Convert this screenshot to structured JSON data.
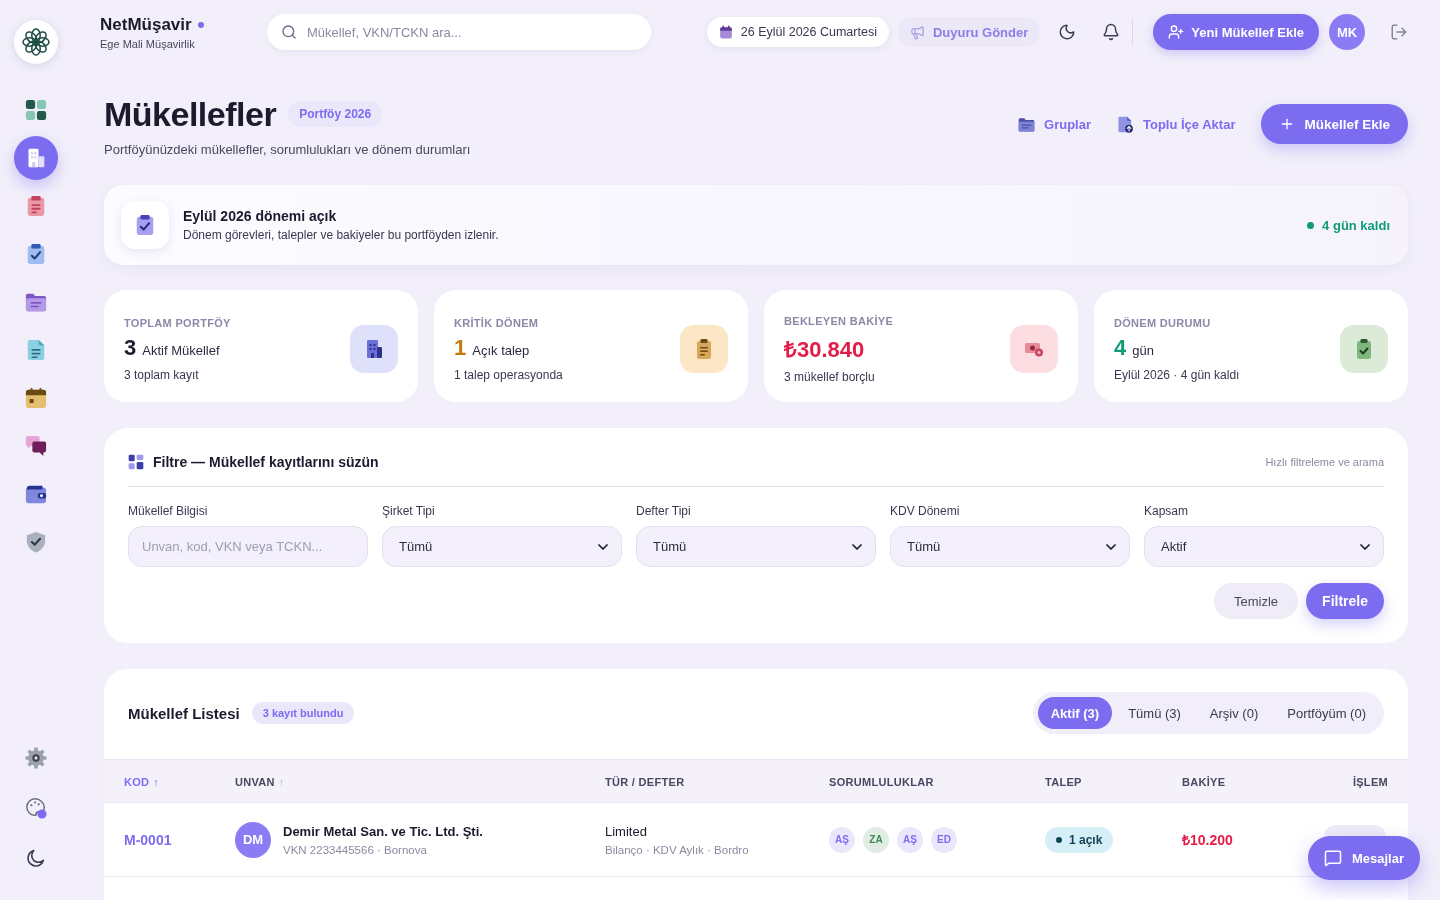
{
  "sidebar": {
    "nav": [
      {
        "selected": false
      },
      {
        "selected": true
      },
      {
        "selected": false
      },
      {
        "selected": false
      },
      {
        "selected": false
      },
      {
        "selected": false
      },
      {
        "selected": false
      },
      {
        "selected": false
      },
      {
        "selected": false
      },
      {
        "selected": false
      }
    ]
  },
  "topbar": {
    "brand": {
      "name": "NetMüşavir",
      "subtitle": "Ege Mali Müşavirlik"
    },
    "search": {
      "placeholder": "Mükellef, VKN/TCKN ara..."
    },
    "date": "26 Eylül 2026 Cumartesi",
    "announce_button": "Duyuru Gönder",
    "add_button": "Yeni Mükellef Ekle",
    "avatar": "MK"
  },
  "page_header": {
    "title": "Mükellefler",
    "badge": "Portföy 2026",
    "subtitle": "Portföyünüzdeki mükellefler, sorumlulukları ve dönem durumları",
    "actions": [
      {
        "kind": "link",
        "label": "Gruplar"
      },
      {
        "kind": "link",
        "label": "Toplu İçe Aktar"
      },
      {
        "kind": "primary",
        "label": "Mükellef Ekle"
      }
    ]
  },
  "period_banner": {
    "title": "Eylül 2026 dönemi açık",
    "text": "Dönem görevleri, talepler ve bakiyeler bu portföyden izlenir.",
    "status": "4 gün kaldı"
  },
  "stats": [
    {
      "label": "TOPLAM PORTFÖY",
      "value": "3",
      "unit": "Aktif Mükellef",
      "note": "3 toplam kayıt",
      "color": "#1c1b2e"
    },
    {
      "label": "KRİTİK DÖNEM",
      "value": "1",
      "unit": "Açık talep",
      "note": "1 talep operasyonda",
      "color": "#c27c0e"
    },
    {
      "label": "BEKLEYEN BAKİYE",
      "value": "₺30.840",
      "note": "3 mükellef borçlu",
      "color": "#e11d48"
    },
    {
      "label": "DÖNEM DURUMU",
      "value": "4",
      "unit": "gün",
      "note": "Eylül 2026 · 4 gün kaldı",
      "color": "#0f9b78"
    }
  ],
  "filter": {
    "title": "Filtre — Mükellef kayıtlarını süzün",
    "hint": "Hızlı filtreleme ve arama",
    "fields": [
      {
        "kind": "input",
        "label": "Mükellef Bilgisi",
        "placeholder": "Unvan, kod, VKN veya TCKN..."
      },
      {
        "kind": "select",
        "label": "Şirket Tipi",
        "value": "Tümü"
      },
      {
        "kind": "select",
        "label": "Defter Tipi",
        "value": "Tümü"
      },
      {
        "kind": "select",
        "label": "KDV Dönemi",
        "value": "Tümü"
      },
      {
        "kind": "select",
        "label": "Kapsam",
        "value": "Aktif"
      }
    ],
    "buttons": [
      {
        "kind": "secondary",
        "label": "Temizle"
      },
      {
        "kind": "primary",
        "label": "Filtrele"
      }
    ]
  },
  "list": {
    "title": "Mükellef Listesi",
    "count": "3 kayıt bulundu",
    "tabs": [
      {
        "label": "Aktif (3)",
        "selected": true
      },
      {
        "label": "Tümü (3)",
        "selected": false
      },
      {
        "label": "Arşiv (0)",
        "selected": false
      },
      {
        "label": "Portföyüm (0)",
        "selected": false
      }
    ],
    "table": {
      "columns": [
        {
          "label": "KOD",
          "sort_arrow": "↑",
          "selected": true
        },
        {
          "label": "UNVAN",
          "sort_arrow": "↑",
          "selected": false
        },
        {
          "label": "TÜR / DEFTER",
          "selected": false
        },
        {
          "label": "SORUMLULUKLAR",
          "selected": false
        },
        {
          "label": "TALEP",
          "selected": false
        },
        {
          "label": "BAKİYE",
          "selected": false
        },
        {
          "label": "İŞLEM",
          "selected": false
        }
      ],
      "rows": [
        {
          "code": "M-0001",
          "initials": "DM",
          "name": "Demir Metal San. ve Tic. Ltd. Şti.",
          "details": "VKN 2233445566 · Bornova",
          "type": "Limited",
          "books": "Bilanço · KDV Aylık · Bordro",
          "responsibles": [
            {
              "initials": "AŞ",
              "color": "#7b6cf0"
            },
            {
              "initials": "ZA",
              "color": "#3f8a55"
            },
            {
              "initials": "AŞ",
              "color": "#7b6cf0"
            },
            {
              "initials": "ED",
              "color": "#7b6cf0"
            }
          ],
          "request": "1 açık",
          "balance": "₺10.200"
        }
      ]
    }
  },
  "messages_button": "Mesajlar"
}
